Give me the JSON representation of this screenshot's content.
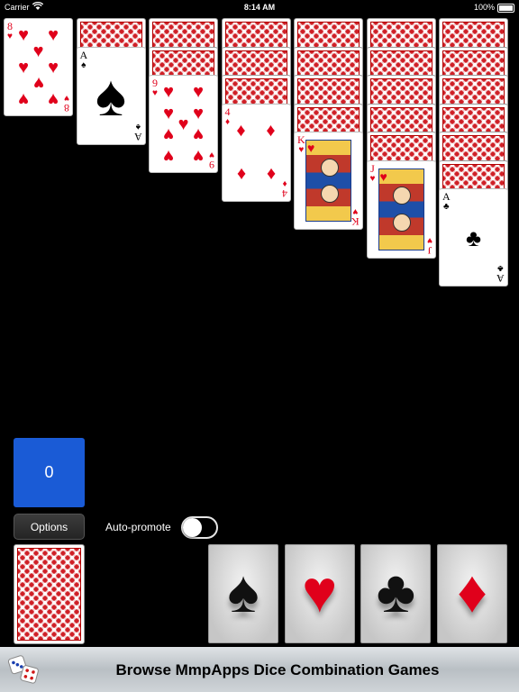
{
  "status_bar": {
    "carrier": "Carrier",
    "time": "8:14 AM",
    "battery": "100%"
  },
  "tableau": [
    {
      "backs": 0,
      "face": {
        "rank": "8",
        "suit": "♥",
        "color": "red"
      }
    },
    {
      "backs": 1,
      "face": {
        "rank": "A",
        "suit": "♠",
        "color": "black"
      }
    },
    {
      "backs": 2,
      "face": {
        "rank": "9",
        "suit": "♥",
        "color": "red"
      }
    },
    {
      "backs": 3,
      "face": {
        "rank": "4",
        "suit": "♦",
        "color": "red"
      }
    },
    {
      "backs": 4,
      "face": {
        "rank": "K",
        "suit": "♥",
        "color": "red"
      }
    },
    {
      "backs": 5,
      "face": {
        "rank": "J",
        "suit": "♥",
        "color": "red"
      }
    },
    {
      "backs": 6,
      "face": {
        "rank": "A",
        "suit": "♣",
        "color": "black"
      }
    }
  ],
  "score": "0",
  "options_label": "Options",
  "auto_promote": {
    "label": "Auto-promote",
    "on": false
  },
  "foundations": [
    {
      "suit": "spades",
      "symbol": "♠",
      "color": "#111111"
    },
    {
      "suit": "hearts",
      "symbol": "♥",
      "color": "#e0001b"
    },
    {
      "suit": "clubs",
      "symbol": "♣",
      "color": "#111111"
    },
    {
      "suit": "diamonds",
      "symbol": "♦",
      "color": "#e0001b"
    }
  ],
  "banner": {
    "text": "Browse MmpApps Dice Combination Games",
    "icon": "dice-icon"
  },
  "colors": {
    "background": "#000000",
    "score_box": "#1a5bd6",
    "card_red": "#e0001b",
    "card_back": "#cf2027"
  }
}
